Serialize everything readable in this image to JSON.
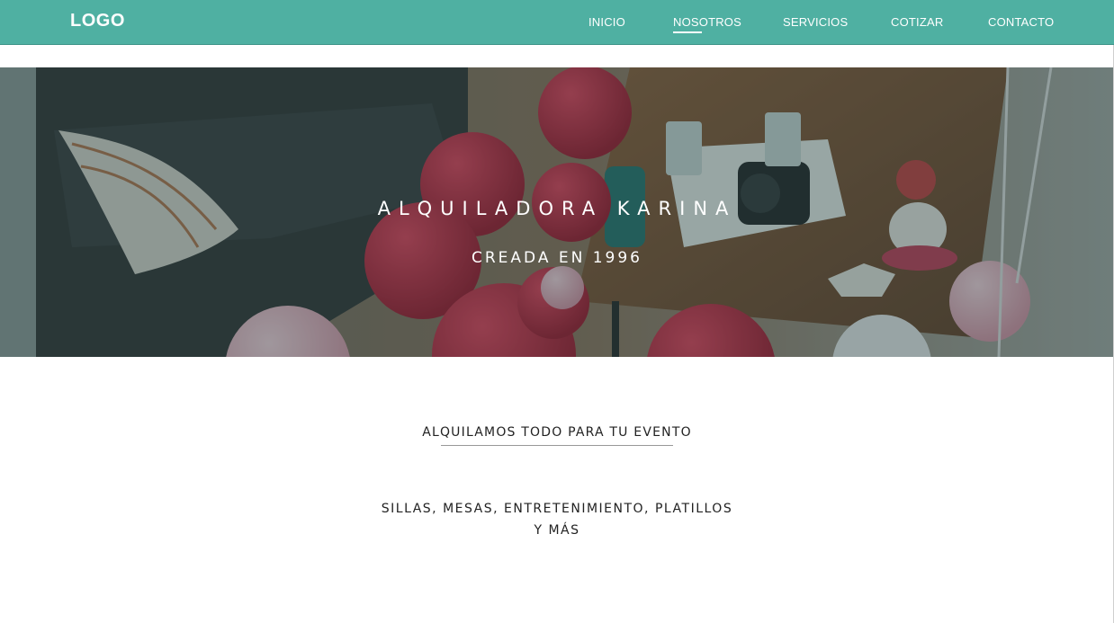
{
  "header": {
    "logo": "LOGO",
    "nav": [
      {
        "label": "INICIO"
      },
      {
        "label": "NOSOTROS"
      },
      {
        "label": "SERVICIOS"
      },
      {
        "label": "COTIZAR"
      },
      {
        "label": "CONTACTO"
      }
    ],
    "active_tab": "NOSOTROS",
    "bar_color": "#4fb0a2"
  },
  "hero": {
    "title": "ALQUILADORA KARINA",
    "subtitle": "CREADA EN 1996"
  },
  "intro": {
    "heading": "ALQUILAMOS TODO PARA TU EVENTO",
    "text_line1": "SILLAS, MESAS, ENTRETENIMIENTO, PLATILLOS",
    "text_line2": "Y MÁS"
  }
}
